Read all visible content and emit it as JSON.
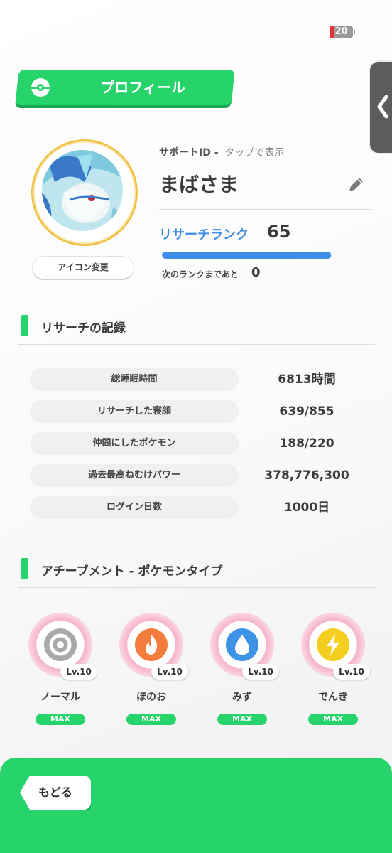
{
  "status_bar": {
    "battery_level": "20",
    "battery_fraction": 0.2,
    "battery_color": "#e33333"
  },
  "colors": {
    "accent_green": "#27d36b",
    "rank_blue": "#3f8de8"
  },
  "header": {
    "title": "プロフィール",
    "icon": "pokeball-icon"
  },
  "side_tab": {
    "icon": "chevron-left-icon"
  },
  "profile": {
    "support_id_label": "サポートID -",
    "support_id_hint": "タップで表示",
    "name": "まばさま",
    "icon_change_label": "アイコン変更",
    "edit_icon": "pencil-icon"
  },
  "rank": {
    "label": "リサーチランク",
    "value": "65",
    "progress_fraction": 0.99,
    "next_label": "次のランクまであと",
    "next_value": "0"
  },
  "records": {
    "title": "リサーチの記録",
    "rows": [
      {
        "label": "総睡眠時間",
        "value": "6813時間"
      },
      {
        "label": "リサーチした寝顔",
        "value": "639/855"
      },
      {
        "label": "仲間にしたポケモン",
        "value": "188/220"
      },
      {
        "label": "過去最高ねむけパワー",
        "value": "378,776,300"
      },
      {
        "label": "ログイン日数",
        "value": "1000日"
      }
    ]
  },
  "achievements": {
    "title": "アチーブメント - ポケモンタイプ",
    "badges": [
      {
        "name": "ノーマル",
        "level": "Lv.10",
        "status": "MAX",
        "icon": "normal-type-icon",
        "color": "#a9a9a9"
      },
      {
        "name": "ほのお",
        "level": "Lv.10",
        "status": "MAX",
        "icon": "fire-type-icon",
        "color": "#f47c3c"
      },
      {
        "name": "みず",
        "level": "Lv.10",
        "status": "MAX",
        "icon": "water-type-icon",
        "color": "#3d93e6"
      },
      {
        "name": "でんき",
        "level": "Lv.10",
        "status": "MAX",
        "icon": "electric-type-icon",
        "color": "#f5cf1f"
      }
    ]
  },
  "footer": {
    "back_label": "もどる"
  }
}
